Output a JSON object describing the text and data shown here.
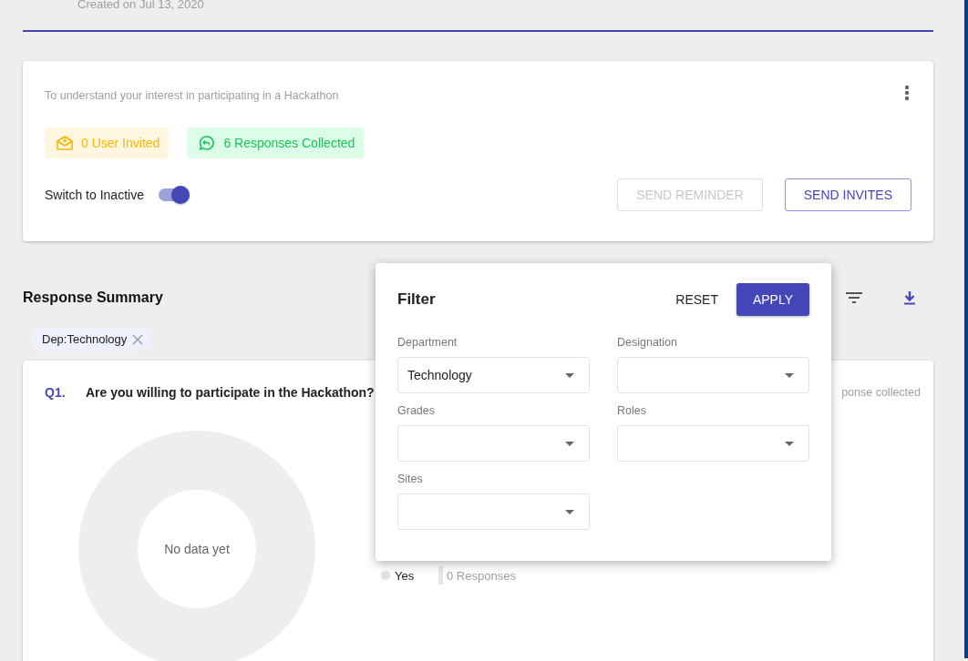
{
  "header": {
    "created": "Created on Jul 13, 2020"
  },
  "survey": {
    "description": "To understand your interest in participating in a Hackathon",
    "stats": [
      {
        "kind": "invited",
        "text": "0 User Invited"
      },
      {
        "kind": "responses",
        "text": "6 Responses Collected"
      }
    ],
    "toggle": {
      "label": "Switch to Inactive",
      "on": true
    },
    "buttons": [
      {
        "label": "SEND REMINDER",
        "disabled": true
      },
      {
        "label": "SEND INVITES",
        "disabled": false
      }
    ]
  },
  "summary": {
    "title": "Response Summary",
    "chips": [
      {
        "label": "Dep:Technology"
      }
    ],
    "question": {
      "number": "Q1.",
      "text": "Are you willing to participate in the Hackathon?",
      "meta": "ponse collected",
      "empty_text": "No data yet",
      "legend": [
        {
          "label": "Yes",
          "count": "0 Responses"
        }
      ]
    }
  },
  "filter": {
    "title": "Filter",
    "reset": "RESET",
    "apply": "APPLY",
    "fields": [
      {
        "label": "Department",
        "value": "Technology"
      },
      {
        "label": "Designation"
      },
      {
        "label": "Grades"
      },
      {
        "label": "Roles"
      },
      {
        "label": "Sites"
      }
    ]
  }
}
